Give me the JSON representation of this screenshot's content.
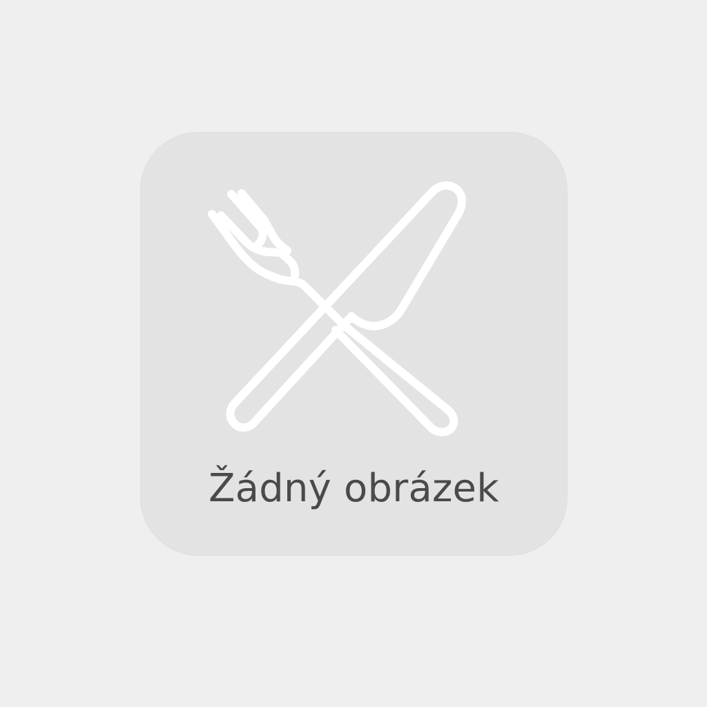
{
  "placeholder": {
    "icon": "fork-and-knife-crossed-icon",
    "label": "Žádný obrázek"
  },
  "colors": {
    "page_background": "#efefef",
    "card_background": "#e3e3e3",
    "icon_stroke": "#ffffff",
    "label_text": "#4a4a4a"
  }
}
